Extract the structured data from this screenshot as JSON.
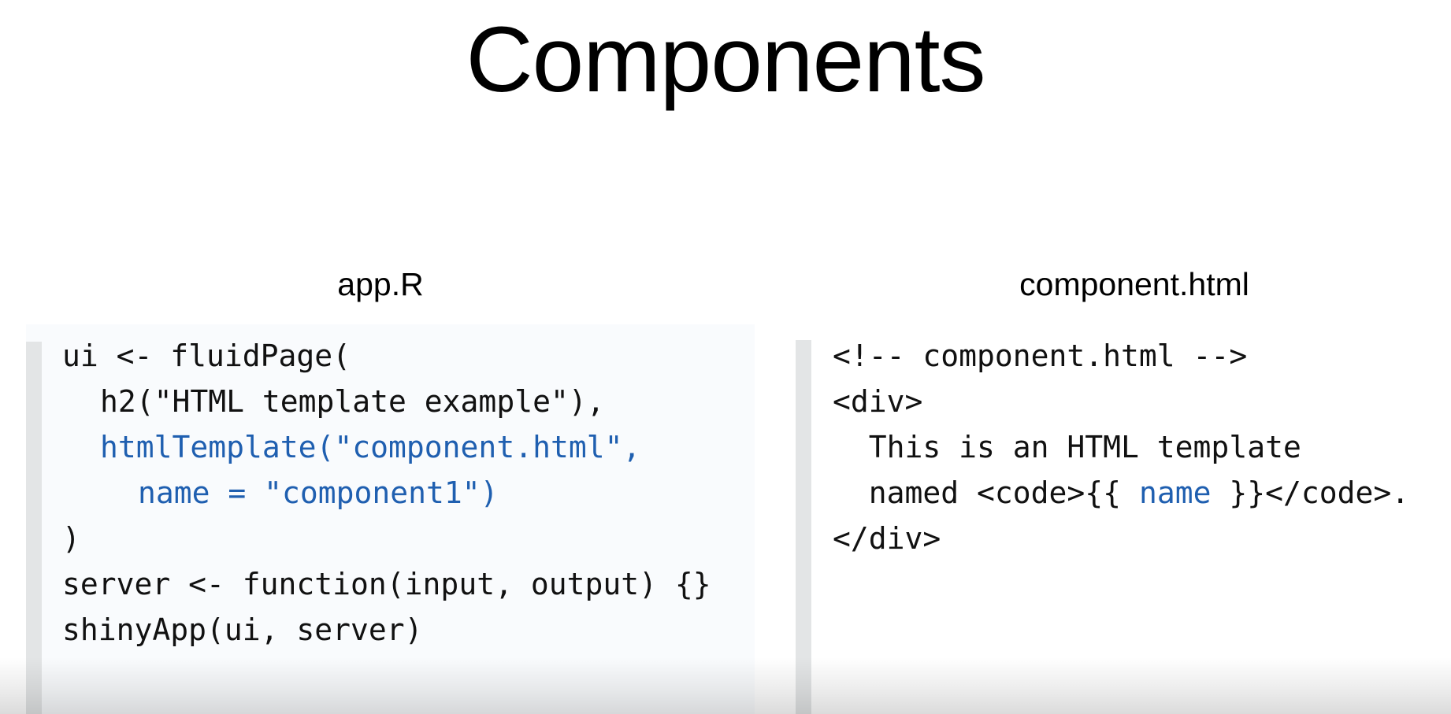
{
  "slide": {
    "title": "Components"
  },
  "left_panel": {
    "caption": "app.R",
    "lines": [
      {
        "indent": "",
        "text": "ui <- fluidPage("
      },
      {
        "indent": "  ",
        "text": "h2(\"HTML template example\"),"
      },
      {
        "indent": "  ",
        "text": "htmlTemplate(\"component.html\","
      },
      {
        "indent": "    ",
        "text": "name = \"component1\")"
      },
      {
        "indent": "",
        "text": ")"
      },
      {
        "indent": "",
        "text": "server <- function(input, output) {}"
      },
      {
        "indent": "",
        "text": "shinyApp(ui, server)"
      }
    ]
  },
  "right_panel": {
    "caption": "component.html",
    "lines": [
      {
        "text": "<!-- component.html -->"
      },
      {
        "text": "<div>"
      },
      {
        "text": "  This is an HTML template"
      },
      {
        "pre": "  named <code>{{ ",
        "highlight": "name",
        "post": " }}</code>."
      },
      {
        "text": "</div>"
      }
    ]
  },
  "colors": {
    "highlight": "#1f5fb0",
    "code_background": "#f9fbfd",
    "code_bar": "#e3e5e6"
  }
}
